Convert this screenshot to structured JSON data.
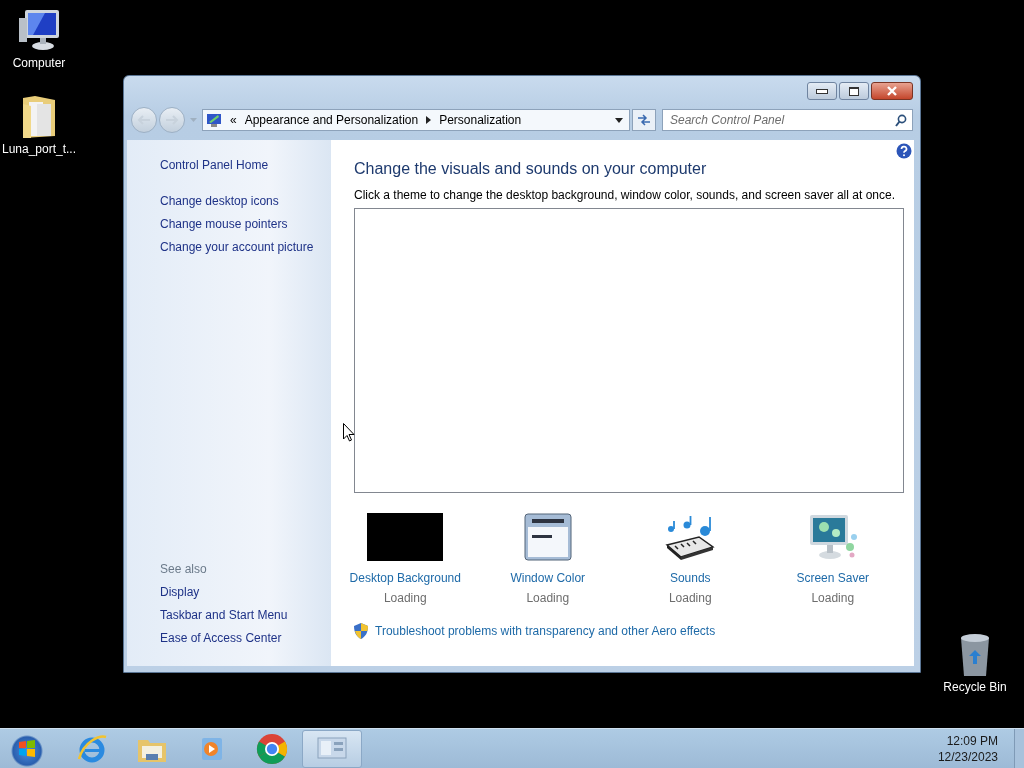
{
  "desktop_icons": [
    {
      "label": "Computer",
      "kind": "computer"
    },
    {
      "label": "Luna_port_t...",
      "kind": "folder"
    },
    {
      "label": "Recycle Bin",
      "kind": "recycle"
    }
  ],
  "window": {
    "address": {
      "prefix": "«",
      "crumbs": [
        "Appearance and Personalization",
        "Personalization"
      ]
    },
    "search": {
      "placeholder": "Search Control Panel"
    },
    "sidebar": {
      "home": "Control Panel Home",
      "links": [
        "Change desktop icons",
        "Change mouse pointers",
        "Change your account picture"
      ],
      "see_also_title": "See also",
      "see_also": [
        "Display",
        "Taskbar and Start Menu",
        "Ease of Access Center"
      ]
    },
    "main": {
      "heading": "Change the visuals and sounds on your computer",
      "description": "Click a theme to change the desktop background, window color, sounds, and screen saver all at once.",
      "items": [
        {
          "kind": "background",
          "label": "Desktop Background",
          "status": "Loading"
        },
        {
          "kind": "window",
          "label": "Window Color",
          "status": "Loading"
        },
        {
          "kind": "sounds",
          "label": "Sounds",
          "status": "Loading"
        },
        {
          "kind": "screensaver",
          "label": "Screen Saver",
          "status": "Loading"
        }
      ],
      "troubleshoot": "Troubleshoot problems with transparency and other Aero effects"
    }
  },
  "taskbar": {
    "apps": [
      {
        "kind": "ie",
        "selected": false
      },
      {
        "kind": "explorer",
        "selected": false
      },
      {
        "kind": "media",
        "selected": false
      },
      {
        "kind": "chrome",
        "selected": false
      },
      {
        "kind": "controlpanel",
        "selected": true
      }
    ],
    "time": "12:09 PM",
    "date": "12/23/2023"
  }
}
